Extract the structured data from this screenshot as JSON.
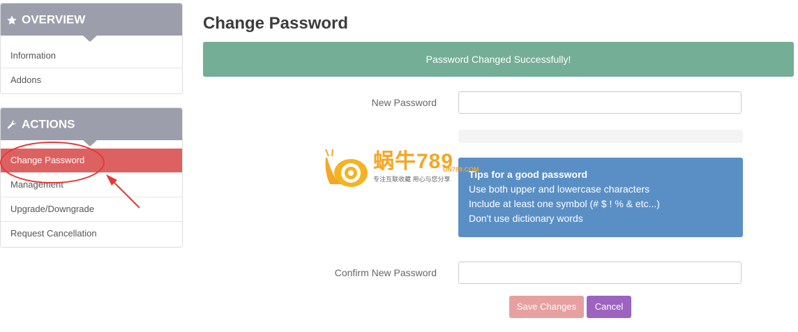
{
  "sidebar": {
    "overview": {
      "title": "OVERVIEW",
      "icon": "star-icon",
      "items": [
        {
          "label": "Information"
        },
        {
          "label": "Addons"
        }
      ]
    },
    "actions": {
      "title": "ACTIONS",
      "icon": "wrench-icon",
      "items": [
        {
          "label": "Change Password",
          "active": true
        },
        {
          "label": "Management"
        },
        {
          "label": "Upgrade/Downgrade"
        },
        {
          "label": "Request Cancellation"
        }
      ]
    }
  },
  "main": {
    "title": "Change Password",
    "alert": "Password Changed Successfully!",
    "new_password_label": "New Password",
    "confirm_password_label": "Confirm New Password",
    "tips": {
      "title": "Tips for a good password",
      "lines": [
        "Use both upper and lowercase characters",
        "Include at least one symbol (# $ ! % & etc...)",
        "Don't use dictionary words"
      ]
    },
    "save_label": "Save Changes",
    "cancel_label": "Cancel"
  },
  "watermark": {
    "brand": "蜗牛789",
    "domain": "UN789.COM",
    "slogan": "专注互联收藏   用心与您分享"
  },
  "colors": {
    "sidebar_header": "#9c9eab",
    "active_item": "#de6161",
    "alert_success": "#74ae96",
    "tips_box": "#5a8fc6",
    "save_button": "#e6a0a0",
    "cancel_button": "#9c63c0",
    "annotation": "#e53935"
  }
}
